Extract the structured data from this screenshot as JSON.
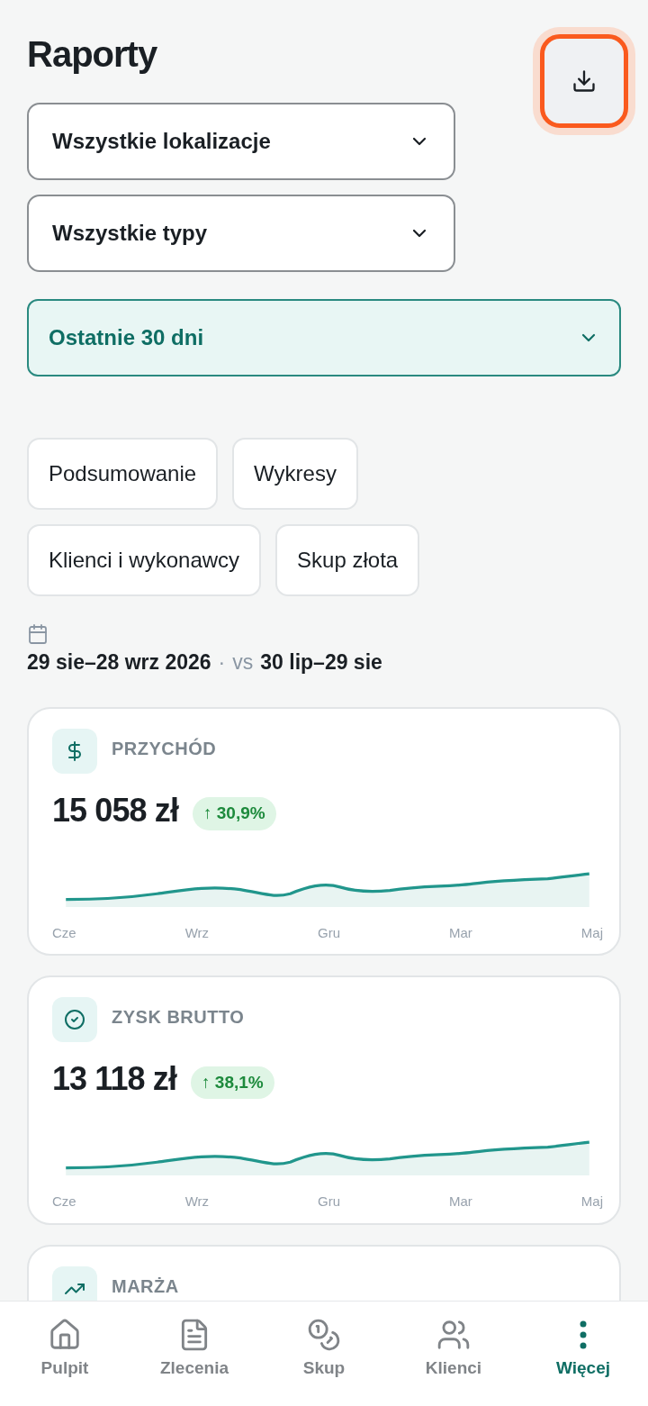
{
  "header": {
    "title": "Raporty"
  },
  "filters": [
    {
      "label": "Wszystkie lokalizacje",
      "highlighted": false
    },
    {
      "label": "Wszystkie typy",
      "highlighted": false
    },
    {
      "label": "Ostatnie 30 dni",
      "highlighted": true
    }
  ],
  "tabs": [
    [
      "Podsumowanie",
      "Wykresy"
    ],
    [
      "Klienci i wykonawcy",
      "Skup złota"
    ]
  ],
  "period": {
    "current": "29 sie–28 wrz 2026",
    "separator": "·",
    "vs": "vs",
    "previous": "30 lip–29 sie"
  },
  "cards": [
    {
      "kind": "revenue",
      "label": "PRZYCHÓD",
      "value": "15 058 zł",
      "change": "↑ 30,9%",
      "months": [
        "Cze",
        "Wrz",
        "Gru",
        "Mar",
        "Maj"
      ]
    },
    {
      "kind": "profit",
      "label": "ZYSK BRUTTO",
      "value": "13 118 zł",
      "change": "↑ 38,1%",
      "months": [
        "Cze",
        "Wrz",
        "Gru",
        "Mar",
        "Maj"
      ]
    },
    {
      "kind": "margin",
      "label": "MARŻA"
    }
  ],
  "nav": [
    {
      "kind": "home",
      "label": "Pulpit",
      "selected": false
    },
    {
      "kind": "orders",
      "label": "Zlecenia",
      "selected": false
    },
    {
      "kind": "buy",
      "label": "Skup",
      "selected": false
    },
    {
      "kind": "clients",
      "label": "Klienci",
      "selected": false
    },
    {
      "kind": "more",
      "label": "Więcej",
      "selected": true
    }
  ]
}
